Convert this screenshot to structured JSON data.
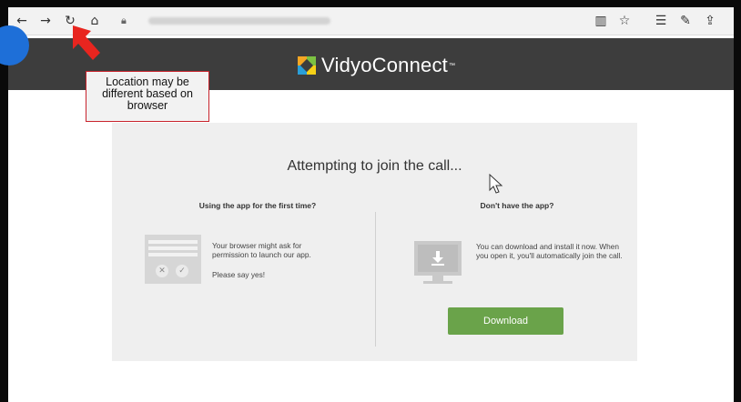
{
  "browser": {
    "icons": {
      "back": "back-arrow-icon",
      "forward": "forward-arrow-icon",
      "refresh": "refresh-icon",
      "home": "home-icon",
      "lock": "lock-icon",
      "reading_view": "reading-view-icon",
      "favorite": "favorite-star-icon",
      "favorites_list": "favorites-list-icon",
      "pen": "pen-icon",
      "share": "share-icon"
    }
  },
  "header": {
    "logo_text": "VidyoConnect",
    "logo_tm": "™",
    "bg_color": "#3d3d3d"
  },
  "callout": {
    "text": "Location may be different based on browser",
    "border_color": "#c8232c",
    "arrow_color": "#e8251f"
  },
  "panel": {
    "title": "Attempting to join the call...",
    "left": {
      "heading": "Using the app for the first time?",
      "text1": "Your browser might ask for permission to launch our app.",
      "text2": "Please say yes!"
    },
    "right": {
      "heading": "Don't have the app?",
      "text": "You can download and install it now. When you open it, you'll automatically join the call.",
      "button_label": "Download",
      "button_color": "#6aa34a"
    }
  }
}
